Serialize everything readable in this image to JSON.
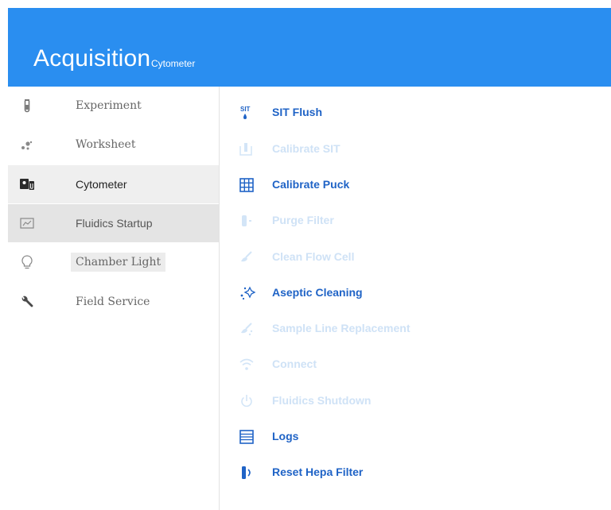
{
  "header": {
    "title": "Acquisition",
    "subtitle": "Cytometer",
    "color": "#2a8ef0"
  },
  "sidebar": {
    "items": [
      {
        "label": "Experiment",
        "icon": "test-tube-icon",
        "state": "normal"
      },
      {
        "label": "Worksheet",
        "icon": "dots-icon",
        "state": "normal"
      },
      {
        "label": "Cytometer",
        "icon": "cytometer-icon",
        "state": "selected"
      },
      {
        "label": "Fluidics Startup",
        "icon": "chart-icon",
        "state": "hover"
      },
      {
        "label": "Chamber Light",
        "icon": "lightbulb-icon",
        "state": "highlighted"
      },
      {
        "label": "Field Service",
        "icon": "wrench-icon",
        "state": "normal"
      }
    ]
  },
  "actions": [
    {
      "label": "SIT Flush",
      "icon": "sit-flush-icon",
      "enabled": true
    },
    {
      "label": "Calibrate SIT",
      "icon": "calibrate-sit-icon",
      "enabled": false
    },
    {
      "label": "Calibrate Puck",
      "icon": "grid-icon",
      "enabled": true
    },
    {
      "label": "Purge Filter",
      "icon": "purge-filter-icon",
      "enabled": false
    },
    {
      "label": "Clean Flow Cell",
      "icon": "brush-icon",
      "enabled": false
    },
    {
      "label": "Aseptic Cleaning",
      "icon": "sparkle-icon",
      "enabled": true
    },
    {
      "label": "Sample Line Replacement",
      "icon": "brush-drops-icon",
      "enabled": false
    },
    {
      "label": "Connect",
      "icon": "wifi-icon",
      "enabled": false
    },
    {
      "label": "Fluidics Shutdown",
      "icon": "power-icon",
      "enabled": false
    },
    {
      "label": "Logs",
      "icon": "logs-icon",
      "enabled": true
    },
    {
      "label": "Reset Hepa Filter",
      "icon": "hepa-filter-icon",
      "enabled": true
    }
  ],
  "colors": {
    "enabled": "#1f63c6",
    "disabled": "#cfe2f6",
    "icon_enabled": "#1f63c6",
    "icon_disabled": "#d3e5f7"
  }
}
